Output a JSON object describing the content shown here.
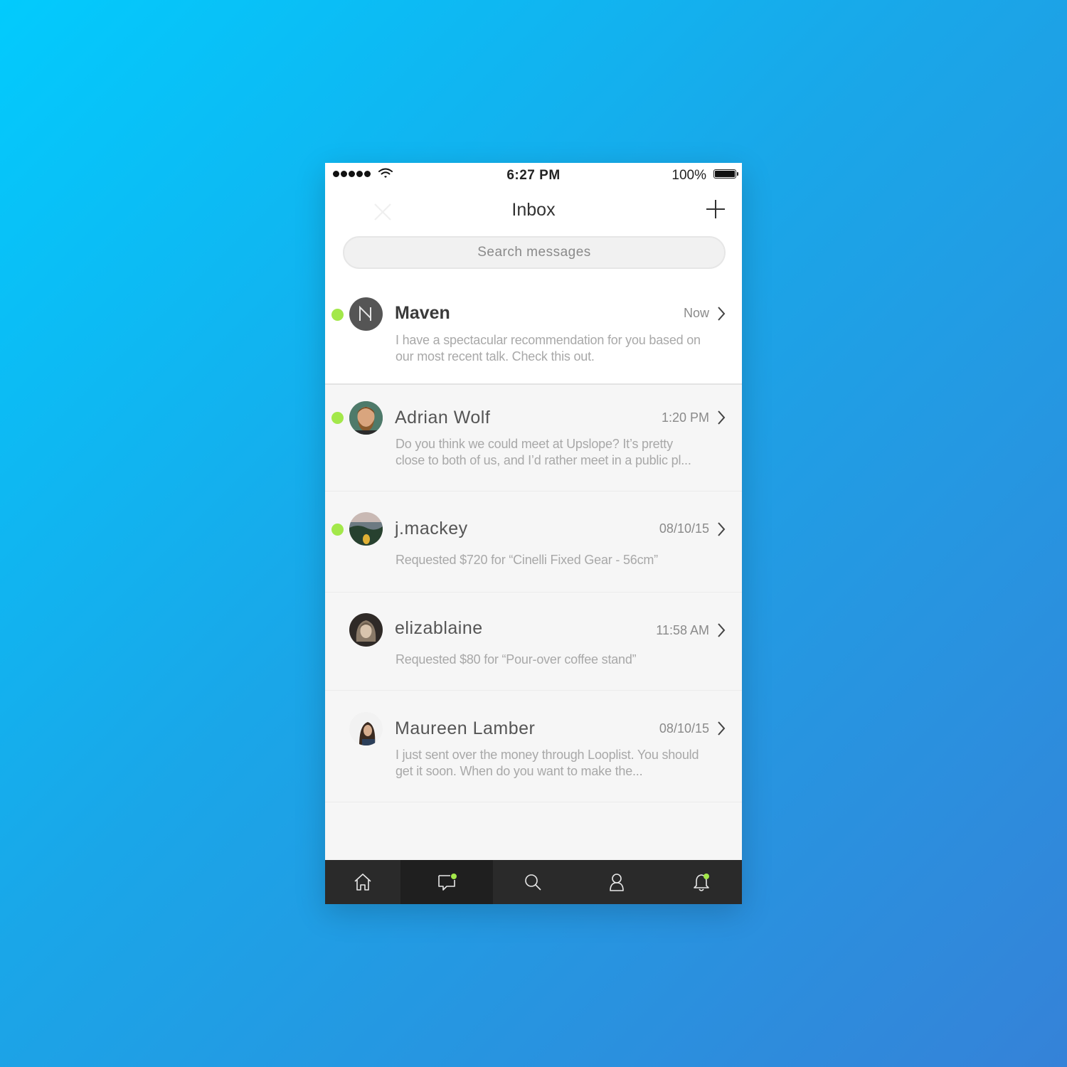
{
  "status_bar": {
    "time": "6:27 PM",
    "battery": "100%",
    "signal_icon": "signal-dots-icon",
    "wifi_icon": "wifi-icon",
    "battery_icon": "battery-icon"
  },
  "header": {
    "title": "Inbox",
    "close_icon": "close-icon",
    "add_icon": "plus-icon"
  },
  "search": {
    "placeholder": "Search messages"
  },
  "conversations": [
    {
      "name": "Maven",
      "time": "Now",
      "preview": "I have a spectacular recommendation for you based on our most recent talk. Check this out.",
      "online": true,
      "unread": true
    },
    {
      "name": "Adrian Wolf",
      "time": "1:20 PM",
      "preview": "Do you think we could meet at Upslope? It’s pretty close to both of us, and I’d rather meet in a public pl...",
      "online": true,
      "unread": false
    },
    {
      "name": "j.mackey",
      "time": "08/10/15",
      "preview": "Requested $720 for “Cinelli Fixed Gear - 56cm”",
      "online": true,
      "unread": false
    },
    {
      "name": "elizablaine",
      "time": "11:58 AM",
      "preview": "Requested $80 for “Pour-over coffee stand”",
      "online": false,
      "unread": false
    },
    {
      "name": "Maureen Lamber",
      "time": "08/10/15",
      "preview": "I just sent over the money through Looplist. You should get it soon. When do you want to make the...",
      "online": false,
      "unread": false
    }
  ],
  "tab_bar": {
    "tabs": [
      {
        "icon": "home-icon",
        "active": false,
        "badge": false
      },
      {
        "icon": "chat-icon",
        "active": true,
        "badge": true
      },
      {
        "icon": "search-icon",
        "active": false,
        "badge": false
      },
      {
        "icon": "profile-icon",
        "active": false,
        "badge": false
      },
      {
        "icon": "bell-icon",
        "active": false,
        "badge": true
      }
    ]
  },
  "colors": {
    "online_dot": "#a3e84a",
    "tab_bar": "#2a2a2a",
    "background_start": "#02cbfd",
    "background_end": "#3582d8"
  }
}
